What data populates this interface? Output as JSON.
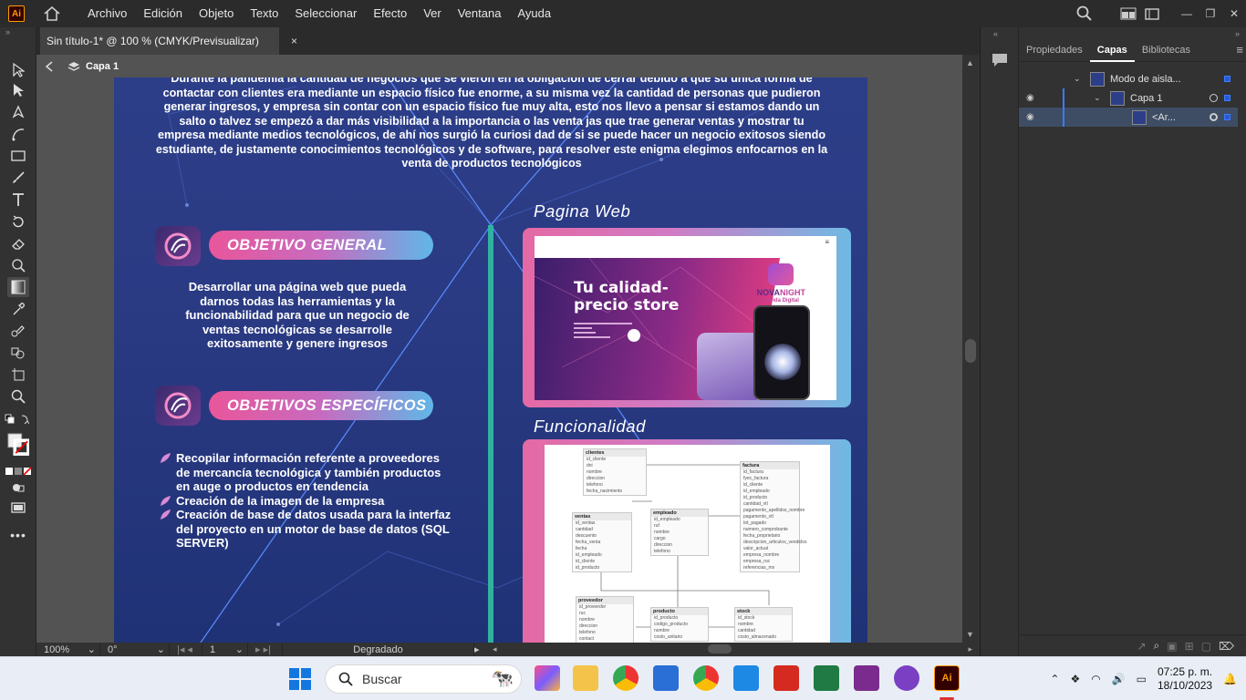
{
  "app": {
    "logo": "Ai"
  },
  "menu": [
    "Archivo",
    "Edición",
    "Objeto",
    "Texto",
    "Seleccionar",
    "Efecto",
    "Ver",
    "Ventana",
    "Ayuda"
  ],
  "document_tab": {
    "title": "Sin título-1* @ 100 % (CMYK/Previsualizar)",
    "close": "×"
  },
  "isolation": {
    "layer": "Capa 1"
  },
  "artboard": {
    "intro": "Durante la pandemia la cantidad de negocios que se vieron en la obligación de cerrar debido a que su única forma de contactar con clientes era mediante un espacio físico fue enorme, a su misma vez la cantidad de personas que pudieron generar ingresos, y empresa sin contar con un espacio físico fue muy alta, esto nos llevo a pensar si estamos dando un salto o talvez se empezó a dar más visibilidad a la importancia o las venta jas que trae generar ventas y mostrar tu empresa mediante medios tecnológicos, de ahí nos surgió la curiosi dad de si se puede hacer un negocio exitosos siendo estudiante, de justamente conocimientos tecnológicos y de software, para resolver este enigma elegimos enfocarnos en la venta de productos tecnológicos",
    "objetivo_general": {
      "title": "OBJETIVO GENERAL",
      "text": "Desarrollar una página web que pueda darnos todas las herramientas y la funcionabilidad para que un negocio de ventas tecnológicas se desarrolle exitosamente y genere ingresos"
    },
    "objetivos_especificos": {
      "title": "OBJETIVOS ESPECÍFICOS",
      "items": [
        "Recopilar información referente a proveedores de mercancía tecnológica y también productos en auge o productos en tendencia",
        "Creación de la imagen de la empresa",
        "Creación de base de datos usada para la interfaz del proyecto en un motor de base de datos (SQL SERVER)"
      ]
    },
    "pagina_web": {
      "title": "Pagina Web",
      "hero_line1": "Tu calidad-",
      "hero_line2": "precio store",
      "brand_top": "NOVA",
      "brand_bottom": "NIGHT",
      "brand_sub": "Tienda Digital"
    },
    "funcionalidad": {
      "title": "Funcionalidad",
      "tables": [
        {
          "name": "clientes",
          "fields": [
            "id_cliente",
            "dni",
            "nombre",
            "direccion",
            "telefono",
            "fecha_nacimiento"
          ]
        },
        {
          "name": "factura",
          "fields": [
            "id_factura",
            "fyec_factura",
            "id_cliente",
            "id_empleado",
            "id_producto",
            "cantidad_vtl",
            "pagamento_apellidos_nombre",
            "pagamento_vtl",
            "tot_pagado",
            "numero_comprobante",
            "fecha_proprietario",
            "descripcion_articulos_vendidos",
            "valor_actual",
            "empresa_nombre",
            "empresa_ruc",
            "referencias_ms"
          ]
        },
        {
          "name": "ventas",
          "fields": [
            "id_ventas",
            "cantidad",
            "descuento",
            "fecha_venta",
            "fecha",
            "id_empleado",
            "id_cliente",
            "id_producto"
          ]
        },
        {
          "name": "empleado",
          "fields": [
            "id_empleado",
            "ruf",
            "nombre",
            "cargo",
            "direccion",
            "telefono"
          ]
        },
        {
          "name": "proveedor",
          "fields": [
            "id_proveedor",
            "ruc",
            "nombre",
            "direccion",
            "telefono",
            "contact"
          ]
        },
        {
          "name": "producto",
          "fields": [
            "id_producto",
            "codigo_producto",
            "nombre",
            "costo_unitario"
          ]
        },
        {
          "name": "stock",
          "fields": [
            "id_stock",
            "nombre",
            "cantidad",
            "costo_almacenado"
          ]
        }
      ]
    }
  },
  "statusbar": {
    "zoom": "100%",
    "rotation": "0°",
    "artboard": "1",
    "tool": "Degradado"
  },
  "panel": {
    "tabs": [
      "Propiedades",
      "Capas",
      "Bibliotecas"
    ],
    "active_tab": "Capas",
    "layers": [
      {
        "label": "Modo de aisla..."
      },
      {
        "label": "Capa 1"
      },
      {
        "label": "<Ar..."
      }
    ]
  },
  "taskbar": {
    "search_placeholder": "Buscar",
    "time": "07:25 p. m.",
    "date": "18/10/2023"
  },
  "colors": {
    "accent_pink": "#e9569a",
    "accent_blue": "#5fb7e8",
    "artboard_bg": "#2d3e88",
    "ai_orange": "#ff9a00"
  }
}
